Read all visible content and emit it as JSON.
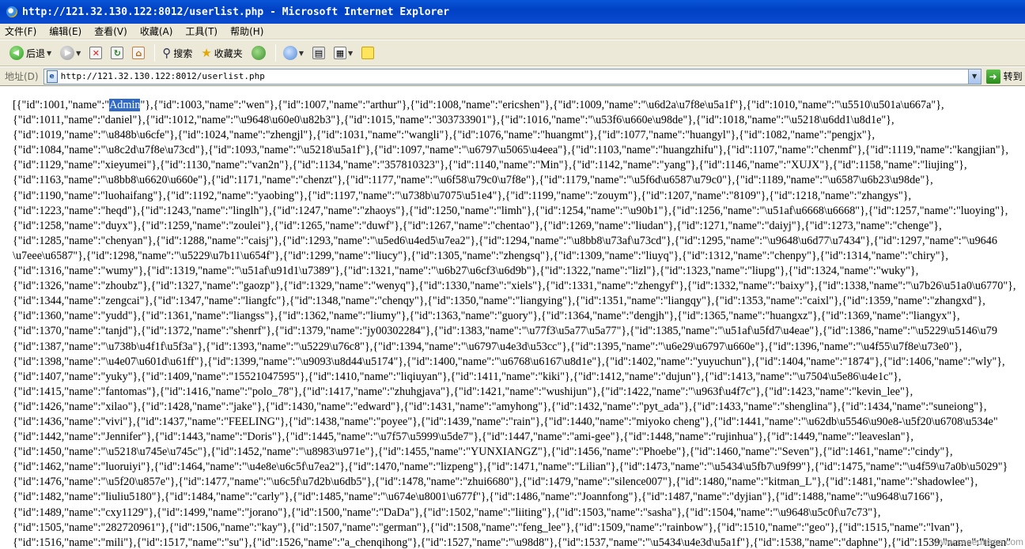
{
  "window": {
    "title": "http://121.32.130.122:8012/userlist.php - Microsoft Internet Explorer"
  },
  "menubar": {
    "items": [
      "文件(F)",
      "编辑(E)",
      "查看(V)",
      "收藏(A)",
      "工具(T)",
      "帮助(H)"
    ]
  },
  "toolbar": {
    "back_label": "后退",
    "search_label": "搜索",
    "favorites_label": "收藏夹"
  },
  "addressbar": {
    "label": "地址(D)",
    "url": "http://121.32.130.122:8012/userlist.php",
    "go_label": "转到"
  },
  "content": {
    "first_prefix": "[{\"id\":1001,\"name\":\"",
    "first_selected": "Admin",
    "first_suffix": "\"},{\"id\":1003,\"name\":\"wen\"},{\"id\":1007,\"name\":\"arthur\"},{\"id\":1008,\"name\":\"ericshen\"},{\"id\":1009,\"name\":\"\\u6d2a\\u7f8e\\u5a1f\"},{\"id\":1010,\"name\":\"\\u5510\\u501a\\u667a\"},",
    "lines": [
      "{\"id\":1011,\"name\":\"daniel\"},{\"id\":1012,\"name\":\"\\u9648\\u60e0\\u82b3\"},{\"id\":1015,\"name\":\"303733901\"},{\"id\":1016,\"name\":\"\\u53f6\\u660e\\u98de\"},{\"id\":1018,\"name\":\"\\u5218\\u6dd1\\u8d1e\"},",
      "{\"id\":1019,\"name\":\"\\u848b\\u6cfe\"},{\"id\":1024,\"name\":\"zhengjl\"},{\"id\":1031,\"name\":\"wangli\"},{\"id\":1076,\"name\":\"huangmt\"},{\"id\":1077,\"name\":\"huangyl\"},{\"id\":1082,\"name\":\"pengjx\"},",
      "{\"id\":1084,\"name\":\"\\u8c2d\\u7f8e\\u73cd\"},{\"id\":1093,\"name\":\"\\u5218\\u5a1f\"},{\"id\":1097,\"name\":\"\\u6797\\u5065\\u4eea\"},{\"id\":1103,\"name\":\"huangzhifu\"},{\"id\":1107,\"name\":\"chenmf\"},{\"id\":1119,\"name\":\"kangjian\"},",
      "{\"id\":1129,\"name\":\"xieyumei\"},{\"id\":1130,\"name\":\"van2n\"},{\"id\":1134,\"name\":\"357810323\"},{\"id\":1140,\"name\":\"Min\"},{\"id\":1142,\"name\":\"yang\"},{\"id\":1146,\"name\":\"XUJX\"},{\"id\":1158,\"name\":\"liujing\"},",
      "{\"id\":1163,\"name\":\"\\u8bb8\\u6620\\u660e\"},{\"id\":1171,\"name\":\"chenzt\"},{\"id\":1177,\"name\":\"\\u6f58\\u79c0\\u7f8e\"},{\"id\":1179,\"name\":\"\\u5f6d\\u6587\\u79c0\"},{\"id\":1189,\"name\":\"\\u6587\\u6b23\\u98de\"},",
      "{\"id\":1190,\"name\":\"luohaifang\"},{\"id\":1192,\"name\":\"yaobing\"},{\"id\":1197,\"name\":\"\\u738b\\u7075\\u51e4\"},{\"id\":1199,\"name\":\"zouym\"},{\"id\":1207,\"name\":\"8109\"},{\"id\":1218,\"name\":\"zhangys\"},",
      "{\"id\":1223,\"name\":\"heqd\"},{\"id\":1243,\"name\":\"linglh\"},{\"id\":1247,\"name\":\"zhaoys\"},{\"id\":1250,\"name\":\"limh\"},{\"id\":1254,\"name\":\"\\u90b1\"},{\"id\":1256,\"name\":\"\\u51af\\u6668\\u6668\"},{\"id\":1257,\"name\":\"luoying\"},",
      "{\"id\":1258,\"name\":\"duyx\"},{\"id\":1259,\"name\":\"zoulei\"},{\"id\":1265,\"name\":\"duwf\"},{\"id\":1267,\"name\":\"chentao\"},{\"id\":1269,\"name\":\"liudan\"},{\"id\":1271,\"name\":\"daiyj\"},{\"id\":1273,\"name\":\"chenge\"},",
      "{\"id\":1285,\"name\":\"chenyan\"},{\"id\":1288,\"name\":\"caisj\"},{\"id\":1293,\"name\":\"\\u5ed6\\u4ed5\\u7ea2\"},{\"id\":1294,\"name\":\"\\u8bb8\\u73af\\u73cd\"},{\"id\":1295,\"name\":\"\\u9648\\u6d77\\u7434\"},{\"id\":1297,\"name\":\"\\u9646",
      "\\u7eee\\u6587\"},{\"id\":1298,\"name\":\"\\u5229\\u7b11\\u654f\"},{\"id\":1299,\"name\":\"liucy\"},{\"id\":1305,\"name\":\"zhengsq\"},{\"id\":1309,\"name\":\"liuyq\"},{\"id\":1312,\"name\":\"chenpy\"},{\"id\":1314,\"name\":\"chiry\"},",
      "{\"id\":1316,\"name\":\"wumy\"},{\"id\":1319,\"name\":\"\\u51af\\u91d1\\u7389\"},{\"id\":1321,\"name\":\"\\u6b27\\u6cf3\\u6d9b\"},{\"id\":1322,\"name\":\"lizl\"},{\"id\":1323,\"name\":\"liupg\"},{\"id\":1324,\"name\":\"wuky\"},",
      "{\"id\":1326,\"name\":\"zhoubz\"},{\"id\":1327,\"name\":\"gaozp\"},{\"id\":1329,\"name\":\"wenyq\"},{\"id\":1330,\"name\":\"xiels\"},{\"id\":1331,\"name\":\"zhengyf\"},{\"id\":1332,\"name\":\"baixy\"},{\"id\":1338,\"name\":\"\\u7b26\\u51a0\\u6770\"},",
      "{\"id\":1344,\"name\":\"zengcai\"},{\"id\":1347,\"name\":\"liangfc\"},{\"id\":1348,\"name\":\"chenqy\"},{\"id\":1350,\"name\":\"liangying\"},{\"id\":1351,\"name\":\"liangqy\"},{\"id\":1353,\"name\":\"caixl\"},{\"id\":1359,\"name\":\"zhangxd\"},",
      "{\"id\":1360,\"name\":\"yudd\"},{\"id\":1361,\"name\":\"liangss\"},{\"id\":1362,\"name\":\"liumy\"},{\"id\":1363,\"name\":\"guory\"},{\"id\":1364,\"name\":\"dengjh\"},{\"id\":1365,\"name\":\"huangxz\"},{\"id\":1369,\"name\":\"liangyx\"},",
      "{\"id\":1370,\"name\":\"tanjd\"},{\"id\":1372,\"name\":\"shenrf\"},{\"id\":1379,\"name\":\"jy00302284\"},{\"id\":1383,\"name\":\"\\u77f3\\u5a77\\u5a77\"},{\"id\":1385,\"name\":\"\\u51af\\u5fd7\\u4eae\"},{\"id\":1386,\"name\":\"\\u5229\\u5146\\u79",
      "{\"id\":1387,\"name\":\"\\u738b\\u4f1f\\u5f3a\"},{\"id\":1393,\"name\":\"\\u5229\\u76c8\"},{\"id\":1394,\"name\":\"\\u6797\\u4e3d\\u53cc\"},{\"id\":1395,\"name\":\"\\u6e29\\u6797\\u660e\"},{\"id\":1396,\"name\":\"\\u4f55\\u7f8e\\u73e0\"},",
      "{\"id\":1398,\"name\":\"\\u4e07\\u601d\\u61ff\"},{\"id\":1399,\"name\":\"\\u9093\\u8d44\\u5174\"},{\"id\":1400,\"name\":\"\\u6768\\u6167\\u8d1e\"},{\"id\":1402,\"name\":\"yuyuchun\"},{\"id\":1404,\"name\":\"1874\"},{\"id\":1406,\"name\":\"wly\"},",
      "{\"id\":1407,\"name\":\"yuky\"},{\"id\":1409,\"name\":\"15521047595\"},{\"id\":1410,\"name\":\"liqiuyan\"},{\"id\":1411,\"name\":\"kiki\"},{\"id\":1412,\"name\":\"dujun\"},{\"id\":1413,\"name\":\"\\u7504\\u5e86\\u4e1c\"},",
      "{\"id\":1415,\"name\":\"fantomas\"},{\"id\":1416,\"name\":\"polo_78\"},{\"id\":1417,\"name\":\"zhuhgjava\"},{\"id\":1421,\"name\":\"wushijun\"},{\"id\":1422,\"name\":\"\\u963f\\u4f7c\"},{\"id\":1423,\"name\":\"kevin_lee\"},",
      "{\"id\":1426,\"name\":\"xilao\"},{\"id\":1428,\"name\":\"jake\"},{\"id\":1430,\"name\":\"edward\"},{\"id\":1431,\"name\":\"amyhong\"},{\"id\":1432,\"name\":\"pyt_ada\"},{\"id\":1433,\"name\":\"shenglina\"},{\"id\":1434,\"name\":\"suneiong\"},",
      "{\"id\":1436,\"name\":\"vivi\"},{\"id\":1437,\"name\":\"FEELING\"},{\"id\":1438,\"name\":\"poyee\"},{\"id\":1439,\"name\":\"rain\"},{\"id\":1440,\"name\":\"miyoko cheng\"},{\"id\":1441,\"name\":\"\\u62db\\u5546\\u90e8-\\u5f20\\u6708\\u534e\"",
      "{\"id\":1442,\"name\":\"Jennifer\"},{\"id\":1443,\"name\":\"Doris\"},{\"id\":1445,\"name\":\"\\u7f57\\u5999\\u5de7\"},{\"id\":1447,\"name\":\"ami-gee\"},{\"id\":1448,\"name\":\"rujinhua\"},{\"id\":1449,\"name\":\"leaveslan\"},",
      "{\"id\":1450,\"name\":\"\\u5218\\u745e\\u745c\"},{\"id\":1452,\"name\":\"\\u8983\\u971e\"},{\"id\":1455,\"name\":\"YUNXIANGZ\"},{\"id\":1456,\"name\":\"Phoebe\"},{\"id\":1460,\"name\":\"Seven\"},{\"id\":1461,\"name\":\"cindy\"},",
      "{\"id\":1462,\"name\":\"luoruiyi\"},{\"id\":1464,\"name\":\"\\u4e8e\\u6c5f\\u7ea2\"},{\"id\":1470,\"name\":\"lizpeng\"},{\"id\":1471,\"name\":\"Lilian\"},{\"id\":1473,\"name\":\"\\u5434\\u5fb7\\u9f99\"},{\"id\":1475,\"name\":\"\\u4f59\\u7a0b\\u5029\"}",
      "{\"id\":1476,\"name\":\"\\u5f20\\u857e\"},{\"id\":1477,\"name\":\"\\u6c5f\\u7d2b\\u6db5\"},{\"id\":1478,\"name\":\"zhui6680\"},{\"id\":1479,\"name\":\"silence007\"},{\"id\":1480,\"name\":\"kitman_L\"},{\"id\":1481,\"name\":\"shadowlee\"},",
      "{\"id\":1482,\"name\":\"liuliu5180\"},{\"id\":1484,\"name\":\"carly\"},{\"id\":1485,\"name\":\"\\u674e\\u8001\\u677f\"},{\"id\":1486,\"name\":\"Joannfong\"},{\"id\":1487,\"name\":\"dyjian\"},{\"id\":1488,\"name\":\"\\u9648\\u7166\"},",
      "{\"id\":1489,\"name\":\"cxy1129\"},{\"id\":1499,\"name\":\"jorano\"},{\"id\":1500,\"name\":\"DaDa\"},{\"id\":1502,\"name\":\"liiting\"},{\"id\":1503,\"name\":\"sasha\"},{\"id\":1504,\"name\":\"\\u9648\\u5c0f\\u7c73\"},",
      "{\"id\":1505,\"name\":\"282720961\"},{\"id\":1506,\"name\":\"kay\"},{\"id\":1507,\"name\":\"german\"},{\"id\":1508,\"name\":\"feng_lee\"},{\"id\":1509,\"name\":\"rainbow\"},{\"id\":1510,\"name\":\"geo\"},{\"id\":1515,\"name\":\"lvan\"},",
      "{\"id\":1516,\"name\":\"mili\"},{\"id\":1517,\"name\":\"su\"},{\"id\":1526,\"name\":\"a_chenqihong\"},{\"id\":1527,\"name\":\"\\u98d8\"},{\"id\":1537,\"name\":\"\\u5434\\u4e3d\\u5a1f\"},{\"id\":1538,\"name\":\"daphne\"},{\"id\":1539,\"name\":\"tigen\""
    ],
    "watermark": "www.seeedbase.com"
  },
  "colors": {
    "titlebar": "#0a4bd0",
    "chrome": "#ece9d8",
    "selection": "#316ac5"
  }
}
